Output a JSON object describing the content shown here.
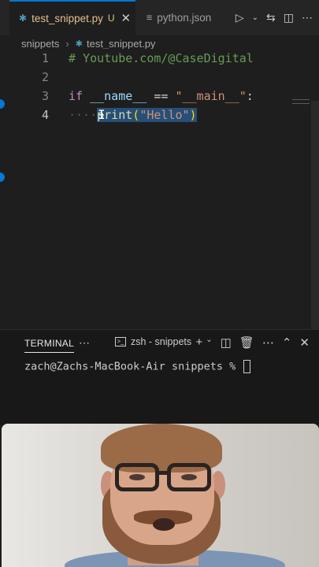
{
  "tabs": [
    {
      "label": "test_snippet.py",
      "badge": "U",
      "icon": "python-file-icon"
    },
    {
      "label": "python.json",
      "icon": "json-file-icon"
    }
  ],
  "breadcrumb": {
    "folder": "snippets",
    "file": "test_snippet.py"
  },
  "editor": {
    "lines": [
      {
        "number": "1",
        "text": "# Youtube.com/@CaseDigital"
      },
      {
        "number": "2",
        "text": ""
      },
      {
        "number": "3",
        "keyword": "if",
        "name_var": "__name__",
        "op": "==",
        "str": "\"__main__\"",
        "colon": ":"
      },
      {
        "number": "4",
        "indent": "····",
        "fn": "print",
        "paren_open": "(",
        "arg": "\"Hello\"",
        "paren_close": ")"
      }
    ]
  },
  "panel": {
    "tab_label": "TERMINAL",
    "terminal_name": "zsh - snippets",
    "prompt": "zach@Zachs-MacBook-Air snippets % "
  },
  "colors": {
    "accent": "#0078d4",
    "modified": "#e2c08d",
    "background": "#1e1e1e"
  }
}
